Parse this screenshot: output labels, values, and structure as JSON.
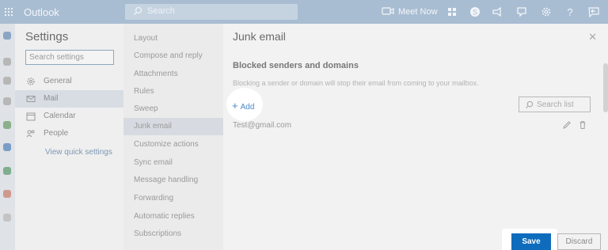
{
  "app": {
    "title": "Outlook"
  },
  "topbar": {
    "search_placeholder": "Search",
    "meet_label": "Meet Now",
    "icons": [
      "video-icon",
      "grid-icon",
      "skype-icon",
      "megaphone-icon",
      "feedback-icon",
      "gear-icon",
      "help-icon",
      "feedback-arrow-icon"
    ]
  },
  "settings": {
    "title": "Settings",
    "search_placeholder": "Search settings",
    "categories": [
      {
        "label": "General",
        "icon": "gear-icon"
      },
      {
        "label": "Mail",
        "icon": "mail-icon",
        "selected": true
      },
      {
        "label": "Calendar",
        "icon": "calendar-icon"
      },
      {
        "label": "People",
        "icon": "people-icon"
      }
    ],
    "quick_settings": "View quick settings"
  },
  "mail_nav": {
    "items": [
      {
        "label": "Layout"
      },
      {
        "label": "Compose and reply"
      },
      {
        "label": "Attachments"
      },
      {
        "label": "Rules"
      },
      {
        "label": "Sweep"
      },
      {
        "label": "Junk email",
        "selected": true
      },
      {
        "label": "Customize actions"
      },
      {
        "label": "Sync email"
      },
      {
        "label": "Message handling"
      },
      {
        "label": "Forwarding"
      },
      {
        "label": "Automatic replies"
      },
      {
        "label": "Subscriptions"
      }
    ]
  },
  "junk": {
    "title": "Junk email",
    "blocked_title": "Blocked senders and domains",
    "blocked_desc": "Blocking a sender or domain will stop their email from coming to your mailbox.",
    "add_label": "Add",
    "search_list_placeholder": "Search list",
    "entries": [
      "Test@gmail.com"
    ]
  },
  "footer": {
    "save_label": "Save",
    "discard_label": "Discard"
  },
  "colors": {
    "accent": "#0f6cbd",
    "topbar": "#a9bdd2",
    "link": "#4a89c8"
  }
}
